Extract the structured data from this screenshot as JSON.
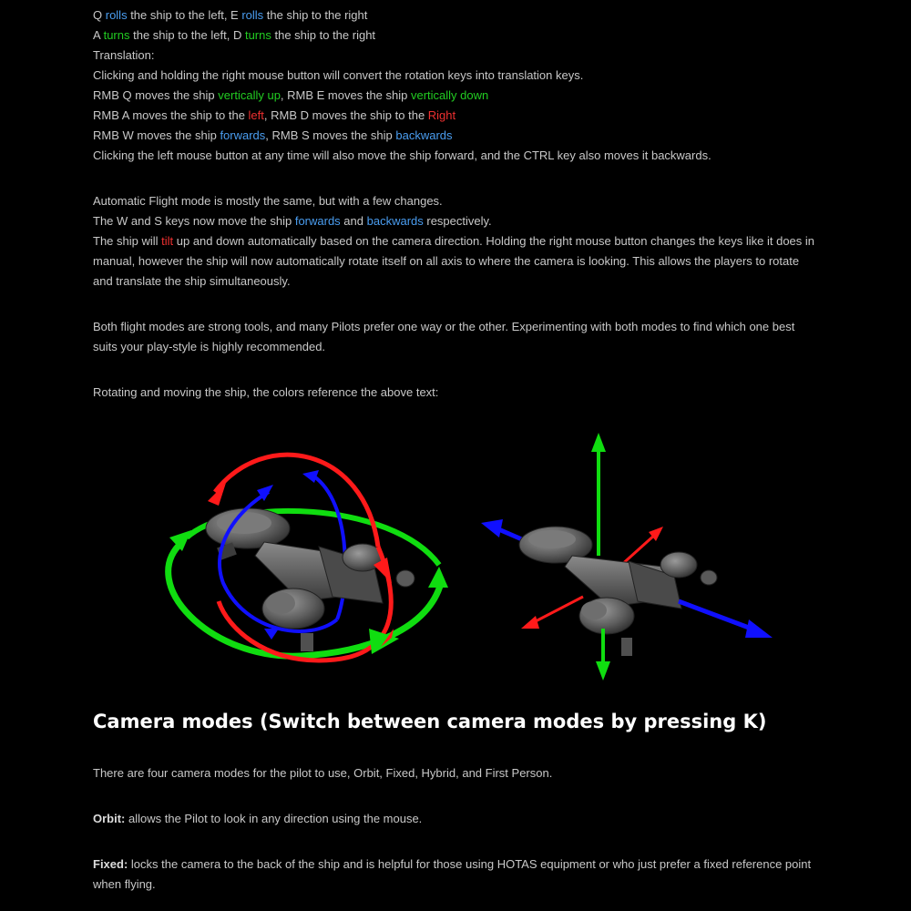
{
  "manual": {
    "roll_line": [
      "Q ",
      "rolls",
      " the ship to the left, E ",
      "rolls",
      " the ship to the right"
    ],
    "turn_line": [
      "A ",
      "turns",
      " the ship to the left, D ",
      "turns",
      " the ship to the right"
    ],
    "translation_heading": "Translation:",
    "translation_intro": "Clicking and holding the right mouse button will convert the rotation keys into translation keys.",
    "vertical_line": [
      "RMB Q moves the ship ",
      "vertically up",
      ", RMB E moves the ship ",
      "vertically down"
    ],
    "lateral_line": [
      "RMB A moves the ship to the ",
      "left",
      ", RMB D moves the ship to the ",
      "Right"
    ],
    "forward_line": [
      "RMB W moves the ship ",
      "forwards",
      ", RMB S moves the ship ",
      "backwards"
    ],
    "lmb_line": "Clicking the left mouse button at any time will also move the ship forward, and the CTRL key also moves it backwards."
  },
  "automatic": {
    "intro": "Automatic Flight mode is mostly the same, but with a few changes.",
    "ws_line": [
      "The W and S keys now move the ship ",
      "forwards",
      " and ",
      "backwards",
      " respectively."
    ],
    "tilt_para": [
      "The ship will ",
      "tilt",
      " up and down automatically based on the camera direction. Holding the right mouse button changes the keys like it does in manual, however the ship will now automatically rotate itself on all axis to where the camera is looking. This allows the players to rotate and translate the ship simultaneously."
    ]
  },
  "both_modes": "Both flight modes are strong tools, and many Pilots prefer one way or the other. Experimenting with both modes to find which one best suits your play-style is highly recommended.",
  "figure_caption": "Rotating and moving the ship, the colors reference the above text:",
  "camera": {
    "heading": "Camera modes (Switch between camera modes by pressing K)",
    "intro": "There are four camera modes for the pilot to use, Orbit, Fixed, Hybrid, and First Person.",
    "orbit_label": "Orbit:",
    "orbit_text": " allows the Pilot to look in any direction using the mouse.",
    "fixed_label": "Fixed:",
    "fixed_text": " locks the camera to the back of the ship and is helpful for those using HOTAS equipment or who just prefer a fixed reference point when flying."
  },
  "colors": {
    "background": "#000000",
    "text": "#c8c8c8",
    "blue": "#4a9df0",
    "green": "#22cc22",
    "red": "#ee3030",
    "axis_blue": "#1010ff",
    "axis_green": "#10dd10",
    "axis_red": "#ff1a1a"
  }
}
